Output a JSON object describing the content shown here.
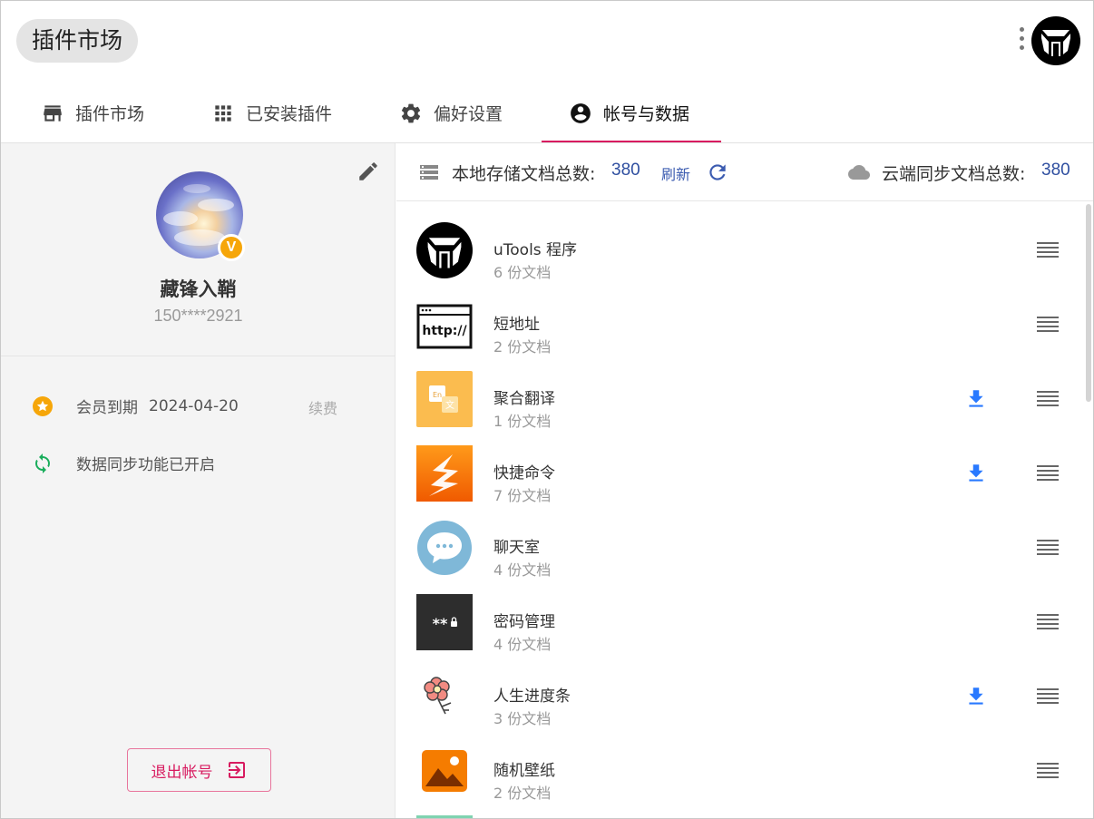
{
  "header": {
    "title": "插件市场"
  },
  "tabs": [
    {
      "label": "插件市场",
      "icon": "store-icon"
    },
    {
      "label": "已安装插件",
      "icon": "apps-grid-icon"
    },
    {
      "label": "偏好设置",
      "icon": "gear-icon"
    },
    {
      "label": "帐号与数据",
      "icon": "account-circle-icon",
      "active": true
    }
  ],
  "user": {
    "name": "藏锋入鞘",
    "phone": "150****2921",
    "vip_badge": "V",
    "member_label": "会员到期",
    "member_expiry": "2024-04-20",
    "renew_label": "续费",
    "sync_status": "数据同步功能已开启",
    "logout_label": "退出帐号"
  },
  "stats": {
    "local_label": "本地存储文档总数:",
    "local_count": "380",
    "refresh_label": "刷新",
    "cloud_label": "云端同步文档总数:",
    "cloud_count": "380"
  },
  "plugins": [
    {
      "name": "uTools 程序",
      "docs": "6 份文档",
      "download": false
    },
    {
      "name": "短地址",
      "docs": "2 份文档",
      "download": false
    },
    {
      "name": "聚合翻译",
      "docs": "1 份文档",
      "download": true
    },
    {
      "name": "快捷命令",
      "docs": "7 份文档",
      "download": true
    },
    {
      "name": "聊天室",
      "docs": "4 份文档",
      "download": false
    },
    {
      "name": "密码管理",
      "docs": "4 份文档",
      "download": false
    },
    {
      "name": "人生进度条",
      "docs": "3 份文档",
      "download": true
    },
    {
      "name": "随机壁纸",
      "docs": "2 份文档",
      "download": false
    }
  ],
  "icon_labels": {
    "short_url": "http://",
    "translate_en": "En",
    "translate_zh": "文",
    "password": "**"
  },
  "colors": {
    "accent": "#d81b60",
    "link": "#2f4fa0",
    "download": "#2979ff",
    "vip": "#f6a609",
    "sync": "#1aad5c"
  }
}
